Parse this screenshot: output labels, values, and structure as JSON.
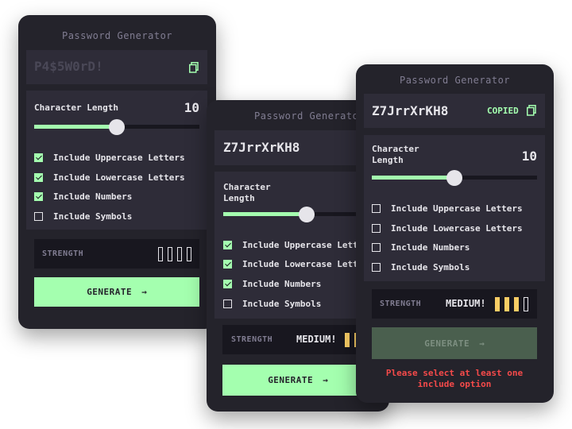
{
  "app_title": "Password Generator",
  "arrow_glyph": "→",
  "cards": [
    {
      "password": "P4$5W0rD!",
      "copied_label": "",
      "length_label": "Character Length",
      "length_value": "10",
      "slider_fraction": 0.5,
      "options": [
        {
          "label": "Include Uppercase Letters",
          "checked": true
        },
        {
          "label": "Include Lowercase Letters",
          "checked": true
        },
        {
          "label": "Include Numbers",
          "checked": true
        },
        {
          "label": "Include Symbols",
          "checked": false
        }
      ],
      "strength_label": "STRENGTH",
      "strength_value": "",
      "strength_level": 0,
      "generate_label": "GENERATE",
      "error": ""
    },
    {
      "password": "Z7JrrXrKH8",
      "copied_label": "",
      "length_label": "Character Length",
      "length_value": "",
      "slider_fraction": 0.5,
      "options": [
        {
          "label": "Include Uppercase Lett",
          "checked": true
        },
        {
          "label": "Include Lowercase Lett",
          "checked": true
        },
        {
          "label": "Include Numbers",
          "checked": true
        },
        {
          "label": "Include Symbols",
          "checked": false
        }
      ],
      "strength_label": "STRENGTH",
      "strength_value": "MEDIUM!",
      "strength_level": 3,
      "generate_label": "GENERATE",
      "error": ""
    },
    {
      "password": "Z7JrrXrKH8",
      "copied_label": "COPIED",
      "length_label": "Character Length",
      "length_value": "10",
      "slider_fraction": 0.5,
      "options": [
        {
          "label": "Include Uppercase Letters",
          "checked": false
        },
        {
          "label": "Include Lowercase Letters",
          "checked": false
        },
        {
          "label": "Include Numbers",
          "checked": false
        },
        {
          "label": "Include Symbols",
          "checked": false
        }
      ],
      "strength_label": "STRENGTH",
      "strength_value": "MEDIUM!",
      "strength_level": 3,
      "generate_label": "GENERATE",
      "error": "Please select at least one include option"
    }
  ],
  "colors": {
    "accent": "#a4ffaf",
    "medium": "#f8cd65",
    "error": "#f64a4a",
    "card": "#24232b",
    "panel": "#2e2c38",
    "dark": "#18171f"
  }
}
